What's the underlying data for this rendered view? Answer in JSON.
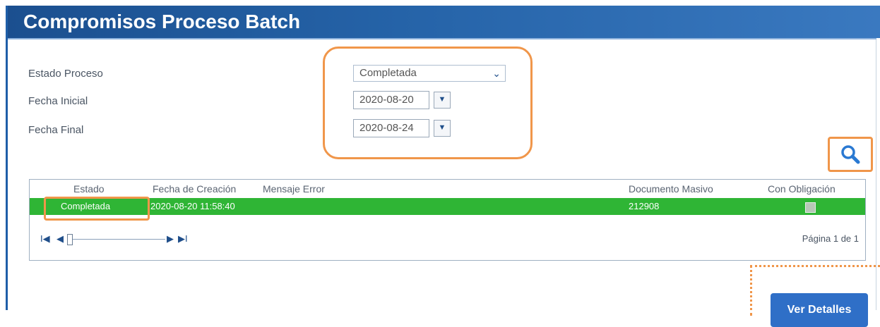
{
  "header": {
    "title": "Compromisos Proceso Batch"
  },
  "filters": {
    "estado_label": "Estado Proceso",
    "estado_value": "Completada",
    "fecha_inicial_label": "Fecha Inicial",
    "fecha_inicial_value": "2020-08-20",
    "fecha_final_label": "Fecha Final",
    "fecha_final_value": "2020-08-24"
  },
  "grid": {
    "columns": [
      "Estado",
      "Fecha de Creación",
      "Mensaje Error",
      "Documento Masivo",
      "Con Obligación"
    ],
    "rows": [
      {
        "estado": "Completada",
        "fecha": "2020-08-20 11:58:40",
        "mensaje": "",
        "documento": "212908"
      }
    ],
    "pager": {
      "first": "I◀",
      "prev": "◀",
      "next": "▶",
      "last": "▶I",
      "page_info": "Página 1 de 1"
    }
  },
  "actions": {
    "ver_detalles": "Ver Detalles"
  },
  "colors": {
    "accent": "#1f5ea8",
    "highlight": "#f0964a",
    "row_selected": "#2fb535",
    "button": "#2f6fc7"
  }
}
